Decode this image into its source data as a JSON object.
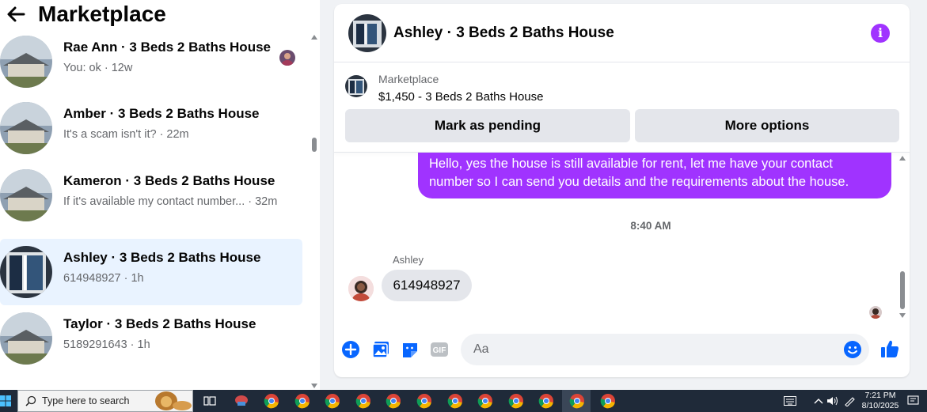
{
  "left_panel": {
    "title": "Marketplace",
    "conversations": [
      {
        "name": "Rae Ann · 3 Beds 2 Baths House",
        "preview": "You: ok · 12w",
        "active": false
      },
      {
        "name": "Amber · 3 Beds 2 Baths House",
        "preview": "It's a scam isn't it? · 22m",
        "active": false
      },
      {
        "name": "Kameron · 3 Beds 2 Baths House",
        "preview": "If it's available my contact number... · 32m",
        "active": false
      },
      {
        "name": "Ashley · 3 Beds 2 Baths House",
        "preview": "614948927 · 1h",
        "active": true
      },
      {
        "name": "Taylor · 3 Beds 2 Baths House",
        "preview": "5189291643 · 1h",
        "active": false
      }
    ]
  },
  "chat": {
    "title": "Ashley · 3 Beds 2 Baths House",
    "marketplace_label": "Marketplace",
    "listing": "$1,450 - 3 Beds 2 Baths House",
    "mark_pending_label": "Mark as pending",
    "more_options_label": "More options",
    "outgoing_message_lines": [
      "Hello, yes the house is still available for rent, let me have your contact",
      "number so I can send you details and the requirements about the house."
    ],
    "timestamp": "8:40 AM",
    "incoming_sender": "Ashley",
    "incoming_message": "614948927",
    "input_placeholder": "Aa"
  },
  "taskbar": {
    "search_placeholder": "Type here to search",
    "time": "7:21 PM",
    "date": "8/10/2025"
  },
  "colors": {
    "accent_purple": "#a033ff",
    "link_blue": "#0866ff",
    "active_row": "#e9f3ff"
  },
  "icons": [
    "back-arrow-icon",
    "info-icon",
    "add-circle-icon",
    "photo-icon",
    "sticker-icon",
    "gif-icon",
    "emoji-icon",
    "thumbs-up-icon",
    "windows-start-icon",
    "search-icon",
    "chrome-icon"
  ]
}
